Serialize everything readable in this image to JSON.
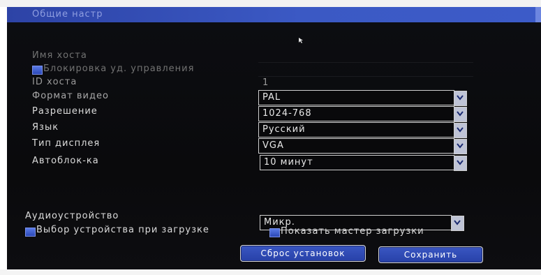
{
  "window": {
    "title": "Общие настр"
  },
  "fields": {
    "host_name_label": "Имя хоста",
    "remote_lock_label": "Блокировка уд. управления",
    "host_id_label": "ID хоста",
    "host_id_value": "1",
    "video_format_label": "Формат видео",
    "video_format_value": "PAL",
    "resolution_label": "Разрешение",
    "resolution_value": "1024-768",
    "language_label": "Язык",
    "language_value": "Русский",
    "display_type_label": "Тип дисплея",
    "display_type_value": "VGA",
    "autolock_label": "Автоблок-ка",
    "autolock_value": "10 минут",
    "audio_device_label": "Аудиоустройство",
    "audio_device_value": "Микр.",
    "boot_device_select_label": "Выбор устройства при загрузке",
    "show_boot_wizard_label": "Показать мастер загрузки"
  },
  "buttons": {
    "reset_label": "Сброс установок",
    "save_label": "Сохранить"
  },
  "colors": {
    "title_bar": "#3b59c4",
    "background": "#0b0b0d",
    "checkbox": "#3a5bd0"
  }
}
